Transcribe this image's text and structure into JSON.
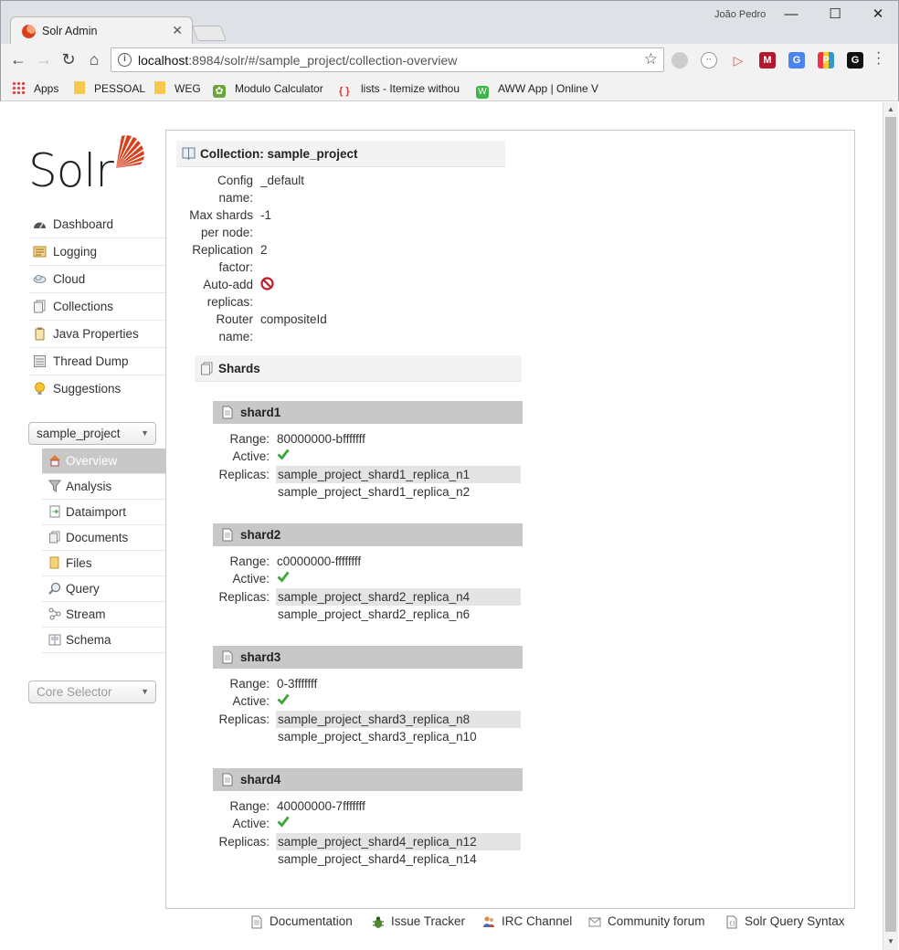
{
  "browser": {
    "tab_title": "Solr Admin",
    "user_name": "João Pedro",
    "url_host": "localhost",
    "url_rest": ":8984/solr/#/sample_project/collection-overview",
    "bookmarks": [
      {
        "label": "Apps",
        "icon": "apps-grid-icon"
      },
      {
        "label": "PESSOAL",
        "icon": "folder-icon"
      },
      {
        "label": "WEG",
        "icon": "folder-icon"
      },
      {
        "label": "Modulo Calculator",
        "icon": "gear-icon"
      },
      {
        "label": "lists - Itemize withou",
        "icon": "braces-icon"
      },
      {
        "label": "AWW App | Online V",
        "icon": "aww-icon"
      }
    ],
    "colors": {
      "chrome": "#dee1e6",
      "toolbar": "#f2f2f2"
    }
  },
  "sidebar": {
    "logo_text": "Solr",
    "menu": [
      {
        "label": "Dashboard",
        "icon": "dashboard-icon"
      },
      {
        "label": "Logging",
        "icon": "logging-icon"
      },
      {
        "label": "Cloud",
        "icon": "cloud-icon"
      },
      {
        "label": "Collections",
        "icon": "collections-icon"
      },
      {
        "label": "Java Properties",
        "icon": "java-icon"
      },
      {
        "label": "Thread Dump",
        "icon": "thread-dump-icon"
      },
      {
        "label": "Suggestions",
        "icon": "lightbulb-icon"
      }
    ],
    "collection_selector": "sample_project",
    "collection_menu": [
      {
        "label": "Overview",
        "icon": "home-icon",
        "active": true
      },
      {
        "label": "Analysis",
        "icon": "filter-icon"
      },
      {
        "label": "Dataimport",
        "icon": "dataimport-icon"
      },
      {
        "label": "Documents",
        "icon": "documents-icon"
      },
      {
        "label": "Files",
        "icon": "files-icon"
      },
      {
        "label": "Query",
        "icon": "magnifier-icon"
      },
      {
        "label": "Stream",
        "icon": "stream-icon"
      },
      {
        "label": "Schema",
        "icon": "schema-icon"
      }
    ],
    "core_selector_placeholder": "Core Selector"
  },
  "collection": {
    "title": "Collection: sample_project",
    "properties": [
      {
        "label": [
          "Config",
          "name:"
        ],
        "value": "_default"
      },
      {
        "label": [
          "Max shards",
          "per node:"
        ],
        "value": "-1"
      },
      {
        "label": [
          "Replication",
          "factor:"
        ],
        "value": "2"
      },
      {
        "label": [
          "Auto-add",
          "replicas:"
        ],
        "value": "",
        "icon": "disabled-icon"
      },
      {
        "label": [
          "Router",
          "name:"
        ],
        "value": "compositeId"
      }
    ],
    "shards_title": "Shards",
    "shard_labels": {
      "range": "Range:",
      "active": "Active:",
      "replicas": "Replicas:"
    },
    "shards": [
      {
        "name": "shard1",
        "range": "80000000-bfffffff",
        "active": true,
        "replicas": [
          "sample_project_shard1_replica_n1",
          "sample_project_shard1_replica_n2"
        ]
      },
      {
        "name": "shard2",
        "range": "c0000000-ffffffff",
        "active": true,
        "replicas": [
          "sample_project_shard2_replica_n4",
          "sample_project_shard2_replica_n6"
        ]
      },
      {
        "name": "shard3",
        "range": "0-3fffffff",
        "active": true,
        "replicas": [
          "sample_project_shard3_replica_n8",
          "sample_project_shard3_replica_n10"
        ]
      },
      {
        "name": "shard4",
        "range": "40000000-7fffffff",
        "active": true,
        "replicas": [
          "sample_project_shard4_replica_n12",
          "sample_project_shard4_replica_n14"
        ]
      }
    ]
  },
  "footer": [
    {
      "label": "Documentation",
      "icon": "document-icon"
    },
    {
      "label": "Issue Tracker",
      "icon": "bug-icon"
    },
    {
      "label": "IRC Channel",
      "icon": "people-icon"
    },
    {
      "label": "Community forum",
      "icon": "mail-icon"
    },
    {
      "label": "Solr Query Syntax",
      "icon": "syntax-icon"
    }
  ],
  "colors": {
    "accent": "#d9411e",
    "active_menu": "#c8c8c8",
    "check": "#3aa635",
    "disabled": "#c0202b"
  }
}
